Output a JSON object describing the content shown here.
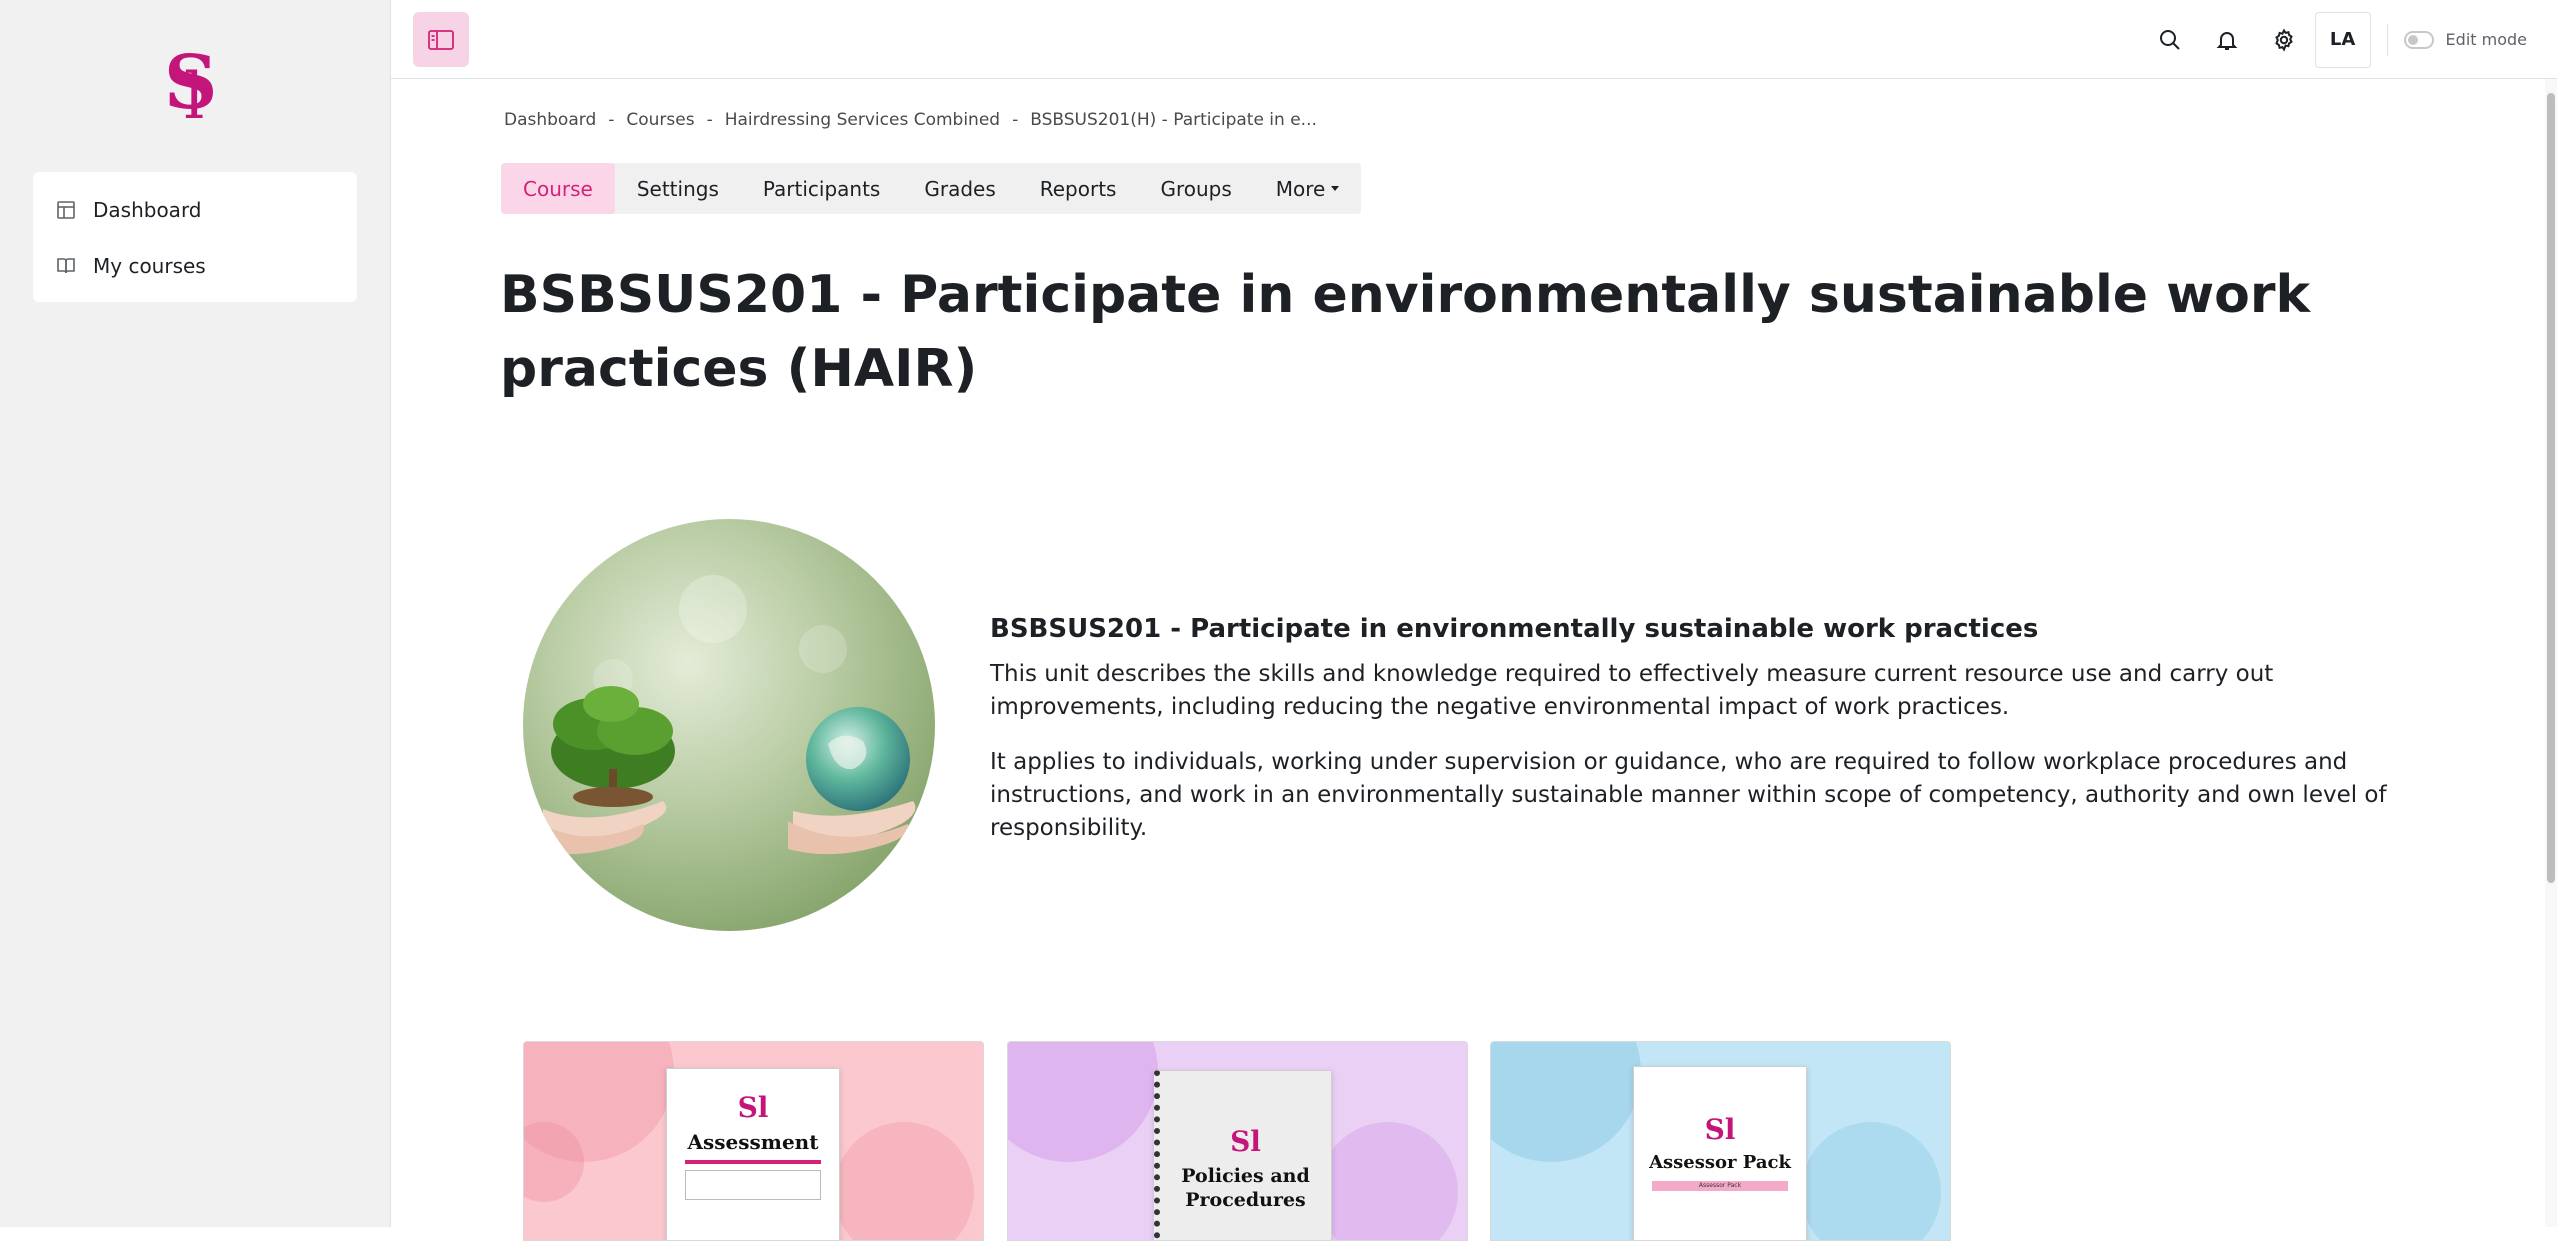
{
  "sidebar": {
    "items": [
      {
        "label": "Dashboard",
        "icon": "dashboard-icon"
      },
      {
        "label": "My courses",
        "icon": "book-icon"
      }
    ]
  },
  "topbar": {
    "avatar_initials": "LA",
    "edit_mode_label": "Edit mode"
  },
  "breadcrumb": [
    "Dashboard",
    "Courses",
    "Hairdressing Services Combined",
    "BSBSUS201(H) - Participate in e..."
  ],
  "tabs": [
    {
      "label": "Course",
      "active": true
    },
    {
      "label": "Settings"
    },
    {
      "label": "Participants"
    },
    {
      "label": "Grades"
    },
    {
      "label": "Reports"
    },
    {
      "label": "Groups"
    },
    {
      "label": "More"
    }
  ],
  "page_title": "BSBSUS201 - Participate in environmentally sustainable work practices (HAIR)",
  "summary": {
    "heading": "BSBSUS201 - Participate in environmentally sustainable work practices",
    "paragraph1": "This unit describes the skills and knowledge required to effectively measure current resource use and carry out improvements, including reducing the negative environmental impact of work practices.",
    "paragraph2": "It applies to individuals, working under supervision or guidance, who are required to follow workplace procedures and instructions, and work in an environmentally sustainable manner within scope of competency, authority and own level of responsibility."
  },
  "cards": [
    {
      "title": "Assessment",
      "bg": "#fbc8cf"
    },
    {
      "title": "Policies and Procedures",
      "bg": "#ead0f5"
    },
    {
      "title": "Assessor Pack",
      "subtitle": "Assessor Pack",
      "bg": "#c3e6f6"
    }
  ],
  "colors": {
    "accent": "#d6217a",
    "logo": "#c4157a"
  }
}
